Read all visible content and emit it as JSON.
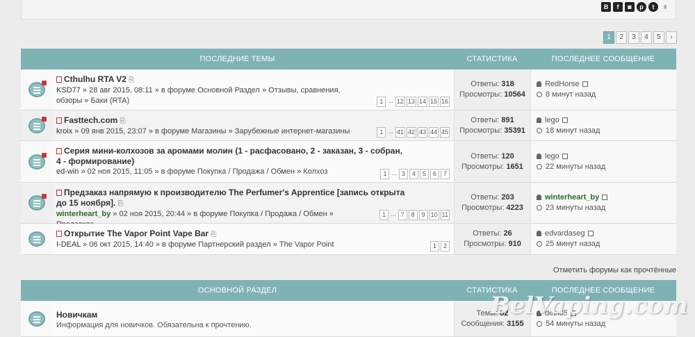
{
  "social_icons": [
    "vk-icon",
    "facebook-icon",
    "instagram-icon",
    "pinterest-icon",
    "twitter-icon",
    "odnoklassniki-icon"
  ],
  "pagination": [
    "1",
    "2",
    "3",
    "4",
    "5",
    "›"
  ],
  "latest": {
    "header": {
      "topics": "ПОСЛЕДНИЕ ТЕМЫ",
      "stats": "СТАТИСТИКА",
      "last": "ПОСЛЕДНЕЕ СООБЩЕНИЕ"
    },
    "rows": [
      {
        "title": "Cthulhu RTA V2",
        "author": "KSD77",
        "meta": " » 28 авг 2015, 08:11 » в форуме Основной Раздел » Отзывы, сравнения, обзоры » Баки (RTA)",
        "pages": [
          "1",
          "...",
          "12",
          "13",
          "14",
          "15",
          "16"
        ],
        "replies_label": "Ответы:",
        "replies": "318",
        "views_label": "Просмотры:",
        "views": "10564",
        "last_user": "RedHorse",
        "last_time": "8 минут назад"
      },
      {
        "title": "Fasttech.com",
        "author": "kroix",
        "meta": " » 09 янв 2015, 23:07 » в форуме Магазины » Зарубежные интернет-магазины",
        "pages": [
          "1",
          "...",
          "41",
          "42",
          "43",
          "44",
          "45"
        ],
        "replies_label": "Ответы:",
        "replies": "891",
        "views_label": "Просмотры:",
        "views": "35391",
        "last_user": "lego",
        "last_time": "18 минут назад"
      },
      {
        "title": "Серия мини-колхозов за аромами молин (1 - расфасовано, 2 - заказан, 3 - собран, 4 - формирование)",
        "author": "ed-win",
        "meta": " » 02 ноя 2015, 11:05 » в форуме Покупка / Продажа / Обмен » Колхоз",
        "pages": [
          "1",
          "...",
          "3",
          "4",
          "5",
          "6",
          "7"
        ],
        "replies_label": "Ответы:",
        "replies": "120",
        "views_label": "Просмотры:",
        "views": "1651",
        "last_user": "lego",
        "last_time": "22 минуты назад"
      },
      {
        "title": "Предзаказ напрямую к производителю The Perfumer's Apprentice [запись открыта до 15 ноября].",
        "author": "winterheart_by",
        "meta": " » 02 ноя 2015, 20:44 » в форуме Покупка / Продажа / Обмен » Предзаказ",
        "pages": [
          "1",
          "...",
          "7",
          "8",
          "9",
          "10",
          "11"
        ],
        "replies_label": "Ответы:",
        "replies": "203",
        "views_label": "Просмотры:",
        "views": "4223",
        "last_user": "winterheart_by",
        "last_time": "23 минуты назад"
      },
      {
        "title": "Открытие The Vapor Point Vape Bar",
        "author": "I-DEAL",
        "meta": " » 06 окт 2015, 14:40 » в форуме Партнерский раздел » The Vapor Point",
        "pages": [
          "1",
          "2"
        ],
        "replies_label": "Ответы:",
        "replies": "26",
        "views_label": "Просмотры:",
        "views": "910",
        "last_user": "edvardaseg",
        "last_time": "25 минут назад"
      }
    ]
  },
  "mark_read": "Отметить форумы как прочтённые",
  "main_section": {
    "header": {
      "topics": "ОСНОВНОЙ РАЗДЕЛ",
      "stats": "СТАТИСТИКА",
      "last": "ПОСЛЕДНЕЕ СООБЩЕНИЕ"
    },
    "rows": [
      {
        "title": "Новичкам",
        "desc": "Информация для новичков. Обязательна к прочтению.",
        "topics_label": "Темы:",
        "topics": "82",
        "posts_label": "Сообщения:",
        "posts": "3155",
        "last_user": "deln05",
        "last_time": "54 минуты назад"
      }
    ]
  },
  "watermark": "BelVaping.com"
}
